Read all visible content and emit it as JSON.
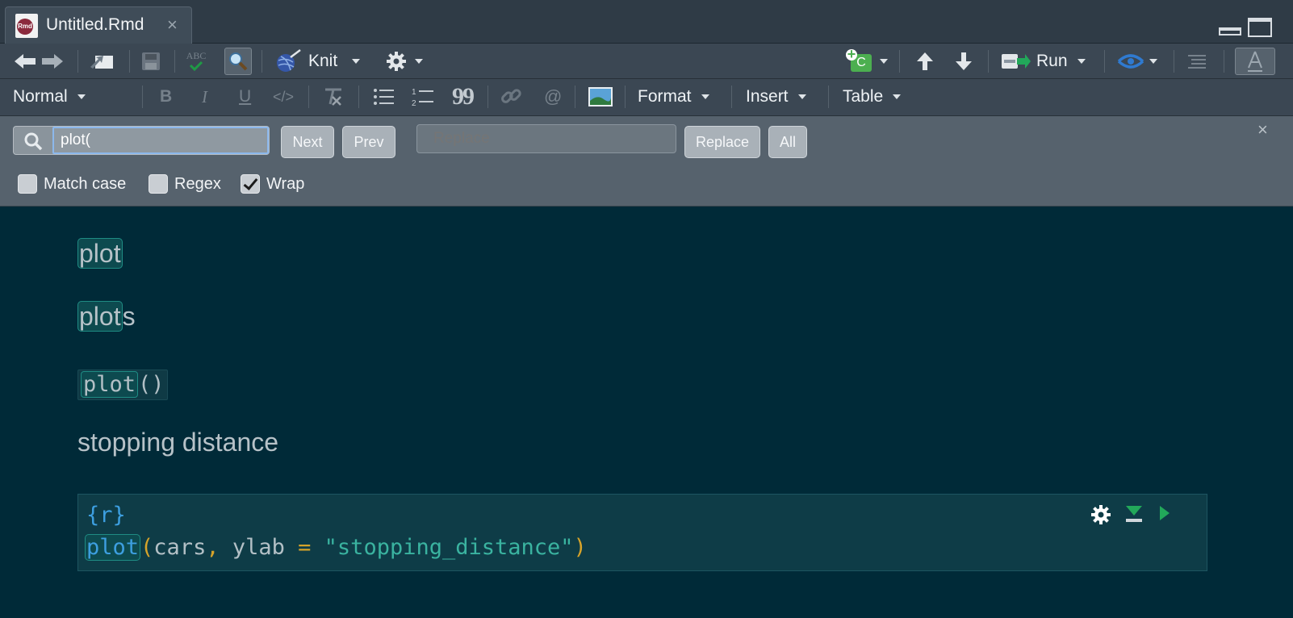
{
  "tab": {
    "title": "Untitled.Rmd",
    "close": "×",
    "icon_label": "Rmd"
  },
  "toolbar1": {
    "knit_label": "Knit",
    "spell_label": "ABC",
    "run_label": "Run",
    "insert_chunk_label": "C"
  },
  "toolbar2": {
    "style_select": "Normal",
    "bold": "B",
    "italic": "I",
    "underline": "U",
    "code": "</>",
    "numbered_list": "1 2",
    "quote": "99",
    "at": "@",
    "format_label": "Format",
    "insert_label": "Insert",
    "table_label": "Table"
  },
  "find": {
    "search_value": "plot(",
    "next_label": "Next",
    "prev_label": "Prev",
    "replace_placeholder": "Replace",
    "replace_button_label": "Replace",
    "all_label": "All",
    "close": "×",
    "options": [
      {
        "label": "Match case",
        "checked": false
      },
      {
        "label": "Regex",
        "checked": false
      },
      {
        "label": "Wrap",
        "checked": true
      }
    ]
  },
  "editor": {
    "line1_match": "plot",
    "line2_match": "plot",
    "line2_rest": "s",
    "line3_match": "plot",
    "line3_rest": "()",
    "line4": "stopping distance",
    "chunk_header": "{r}",
    "chunk_fn": "plot",
    "chunk_open_paren": "(",
    "chunk_args1": "cars",
    "chunk_comma": ",",
    "chunk_args2": " ylab ",
    "chunk_eq": "=",
    "chunk_str": "\"stopping_distance\"",
    "chunk_close_paren": ")"
  },
  "colors": {
    "editor_bg": "#002a38",
    "match_border": "#1f8c84",
    "accent_blue": "#3d9fe0",
    "string": "#3ab3a0",
    "paren": "#d6a32a"
  }
}
